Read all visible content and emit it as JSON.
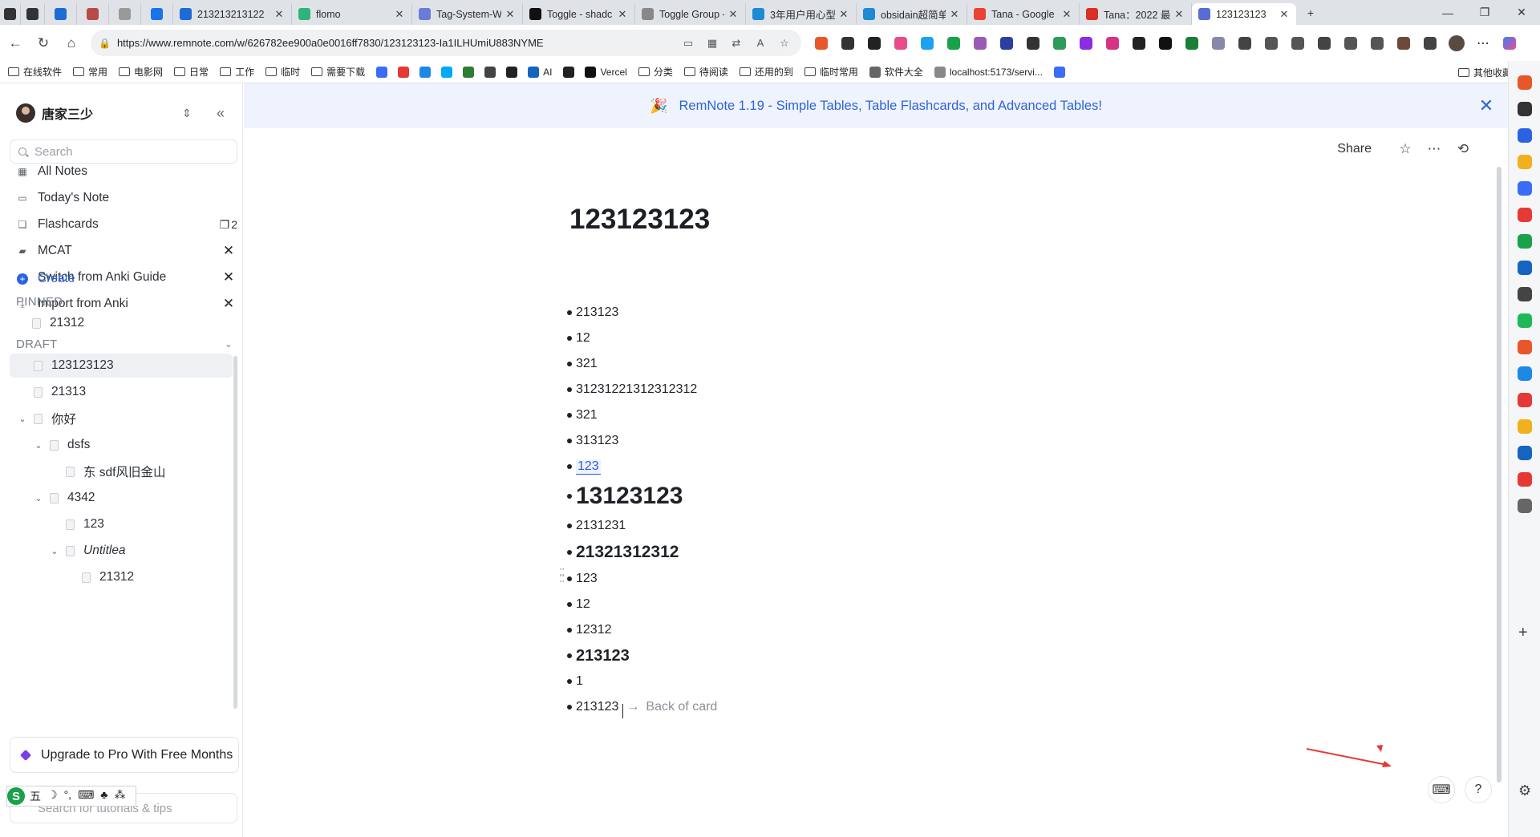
{
  "browser": {
    "tabs": [
      {
        "title": "",
        "icon": "workspaces-icon",
        "color": "#333333",
        "small": true
      },
      {
        "title": "",
        "icon": "tab-actions-icon",
        "color": "#333333",
        "small": true
      },
      {
        "title": "",
        "icon": "remnote-icon",
        "color": "#1e6bd6",
        "small": true
      },
      {
        "title": "",
        "icon": "page-icon",
        "color": "#b94a4a",
        "small": true
      },
      {
        "title": "",
        "icon": "bar-icon",
        "color": "#999999",
        "small": true
      },
      {
        "title": "",
        "icon": "cloud-icon",
        "color": "#1a73e8",
        "small": true
      },
      {
        "title": "213213213122",
        "icon": "remnote-icon",
        "color": "#1e6bd6"
      },
      {
        "title": "flomo",
        "icon": "flomo-icon",
        "color": "#30b37a"
      },
      {
        "title": "Tag-System-Wi",
        "icon": "tag-icon",
        "color": "#6a7bd8"
      },
      {
        "title": "Toggle - shadc",
        "icon": "shadcn-icon",
        "color": "#111111"
      },
      {
        "title": "Toggle Group -",
        "icon": "circle-icon",
        "color": "#888888"
      },
      {
        "title": "3年用户用心型",
        "icon": "bilibili-icon",
        "color": "#1e8ad6"
      },
      {
        "title": "obsidain超简单",
        "icon": "bilibili-icon",
        "color": "#1e8ad6"
      },
      {
        "title": "Tana - Google",
        "icon": "google-icon",
        "color": "#ea4335"
      },
      {
        "title": "Tana：2022 最",
        "icon": "tana-icon",
        "color": "#d93025"
      },
      {
        "title": "123123123",
        "icon": "remnote-icon",
        "color": "#5a6bd6",
        "active": true
      }
    ],
    "new_tab": "+",
    "window": {
      "minimize": "—",
      "restore": "❐",
      "close": "✕"
    },
    "url": "https://www.remnote.com/w/626782ee900a0e0016ff7830/123123123-Ia1ILHUmiU883NYME",
    "url_tools": [
      "split-screen-icon",
      "apps-icon",
      "translate-icon",
      "read-aloud-icon",
      "favorite-star-icon"
    ],
    "extensions": [
      "#e8572a",
      "#333333",
      "#222222",
      "#e84c8b",
      "#1da1f2",
      "#19a24a",
      "#9b59b6",
      "#2c3e9e",
      "#333333",
      "#2d9b5a",
      "#8b2de0",
      "#d63384",
      "#222222",
      "#111111",
      "#1a7f37",
      "#8888aa",
      "#444444",
      "#555555",
      "#555555",
      "#444444",
      "#555555",
      "#555555",
      "#6b4a3a",
      "#444444"
    ],
    "bookmarks": [
      {
        "label": "在线软件",
        "type": "folder"
      },
      {
        "label": "常用",
        "type": "folder"
      },
      {
        "label": "电影网",
        "type": "folder"
      },
      {
        "label": "日常",
        "type": "folder"
      },
      {
        "label": "工作",
        "type": "folder"
      },
      {
        "label": "临时",
        "type": "folder"
      },
      {
        "label": "需要下载",
        "type": "folder"
      },
      {
        "label": "",
        "type": "icon",
        "color": "#3b6cf6"
      },
      {
        "label": "",
        "type": "icon",
        "color": "#e53935"
      },
      {
        "label": "",
        "type": "icon",
        "color": "#1e88e5"
      },
      {
        "label": "",
        "type": "icon",
        "color": "#03a9f4"
      },
      {
        "label": "",
        "type": "icon",
        "color": "#2e7d32"
      },
      {
        "label": "",
        "type": "icon",
        "color": "#444444"
      },
      {
        "label": "",
        "type": "icon",
        "color": "#222222"
      },
      {
        "label": "AI",
        "type": "icon",
        "color": "#1565c0"
      },
      {
        "label": "",
        "type": "icon",
        "color": "#222222"
      },
      {
        "label": "Vercel",
        "type": "icon",
        "color": "#111111"
      },
      {
        "label": "分类",
        "type": "folder"
      },
      {
        "label": "待阅读",
        "type": "folder"
      },
      {
        "label": "还用的到",
        "type": "folder"
      },
      {
        "label": "临时常用",
        "type": "folder"
      },
      {
        "label": "软件大全",
        "type": "icon",
        "color": "#666666"
      },
      {
        "label": "localhost:5173/servi...",
        "type": "icon",
        "color": "#888888"
      },
      {
        "label": "",
        "type": "icon",
        "color": "#3b6cf6"
      }
    ],
    "other_bookmarks": "其他收藏夹"
  },
  "edge_sidebar": {
    "icons": [
      "#e8572a",
      "#333333",
      "#2a63e0",
      "#f2b01e",
      "#3b6cf6",
      "#e53935",
      "#19a24a",
      "#1565c0",
      "#444444",
      "#1db954",
      "#e8572a",
      "#1e88e5",
      "#e53935",
      "#f2b01e",
      "#1565c0",
      "#e53935",
      "#666666"
    ],
    "add": "+",
    "settings": "⚙"
  },
  "sidebar": {
    "workspace": "唐家三少",
    "search_placeholder": "Search",
    "nav": [
      {
        "label": "All Notes",
        "icon": "grid-icon"
      },
      {
        "label": "Today's Note",
        "icon": "calendar-icon"
      },
      {
        "label": "Flashcards",
        "icon": "cards-icon",
        "badge": "2"
      },
      {
        "label": "MCAT",
        "icon": "book-icon",
        "close": "✕"
      },
      {
        "label": "Switch from Anki Guide",
        "icon": "book-icon",
        "close": "✕"
      },
      {
        "label": "Import from Anki",
        "icon": "download-icon",
        "close": "✕"
      }
    ],
    "create": "Create",
    "pinned": {
      "title": "PINNED",
      "items": [
        "21312"
      ]
    },
    "draft": {
      "title": "DRAFT",
      "items": [
        {
          "label": "123123123",
          "depth": 0,
          "selected": true
        },
        {
          "label": "21313",
          "depth": 0
        },
        {
          "label": "你好",
          "depth": 0,
          "expandable": true
        },
        {
          "label": "dsfs",
          "depth": 1,
          "expandable": true
        },
        {
          "label": "东 sdf风旧金山",
          "depth": 2
        },
        {
          "label": "4342",
          "depth": 1,
          "expandable": true
        },
        {
          "label": "123",
          "depth": 2
        },
        {
          "label": "Untitlea",
          "depth": 2,
          "expandable": true,
          "italic": true
        },
        {
          "label": "21312",
          "depth": 3
        }
      ]
    },
    "upgrade": "Upgrade to Pro With Free Months",
    "tutorials_placeholder": "Search for tutorials & tips",
    "ime": [
      "五",
      "☽",
      "°,",
      "⌨",
      "♣",
      "⁂"
    ]
  },
  "banner": {
    "text": "RemNote 1.19 - Simple Tables, Table Flashcards, and Advanced Tables!",
    "close": "✕"
  },
  "topbar": {
    "share": "Share"
  },
  "document": {
    "title": "123123123",
    "blocks": [
      {
        "text": "213123",
        "style": "normal"
      },
      {
        "text": "12",
        "style": "normal"
      },
      {
        "text": "321",
        "style": "normal"
      },
      {
        "text": "31231221312312312",
        "style": "normal"
      },
      {
        "text": "321",
        "style": "normal"
      },
      {
        "text": "313123",
        "style": "normal"
      },
      {
        "text": "123",
        "style": "highlight"
      },
      {
        "text": "13123123",
        "style": "h1"
      },
      {
        "text": "2131231",
        "style": "normal"
      },
      {
        "text": "21321312312",
        "style": "h2"
      },
      {
        "text": "123",
        "style": "normal"
      },
      {
        "text": "12",
        "style": "normal"
      },
      {
        "text": "12312",
        "style": "normal"
      },
      {
        "text": "213123",
        "style": "h3"
      },
      {
        "text": "1",
        "style": "normal"
      },
      {
        "text": "213123",
        "style": "card",
        "back": "Back of card"
      }
    ]
  },
  "help": {
    "question": "?"
  }
}
